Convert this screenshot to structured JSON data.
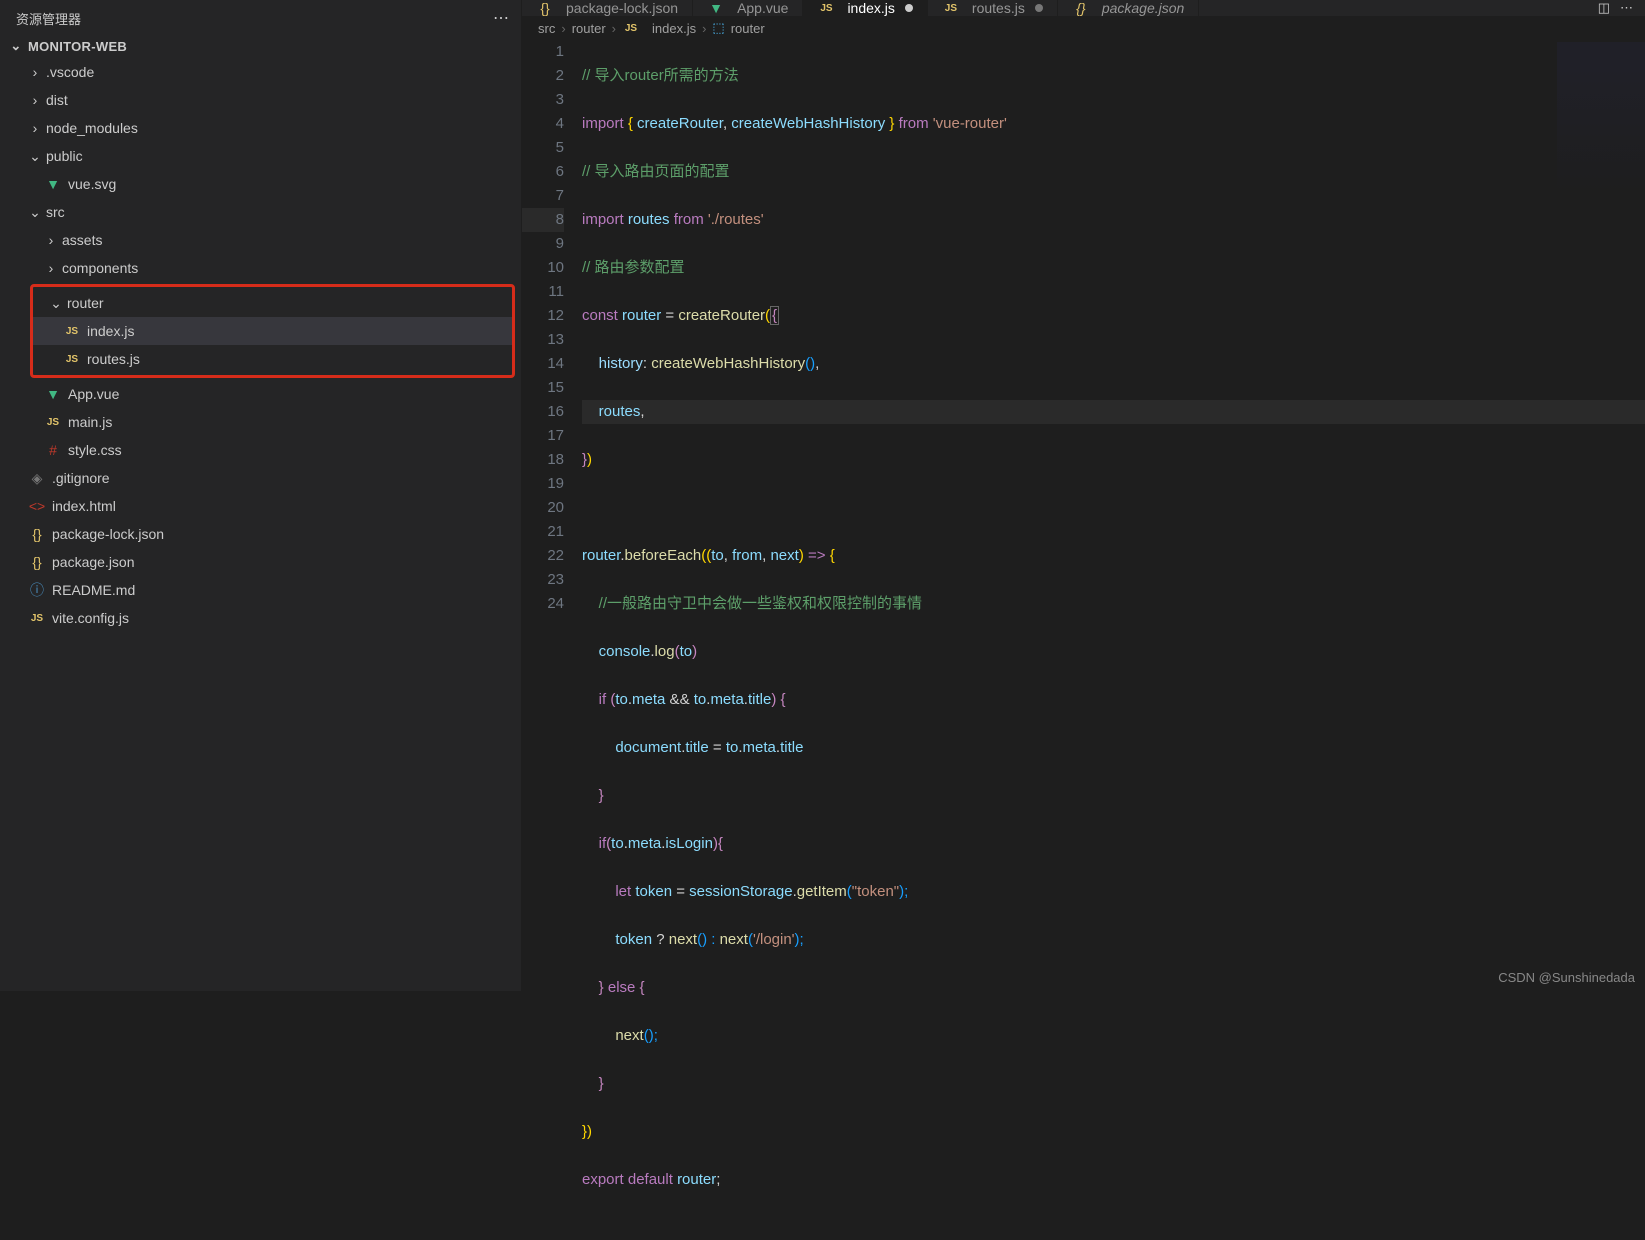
{
  "explorer": {
    "title": "资源管理器"
  },
  "project": {
    "name": "MONITOR-WEB"
  },
  "tree": {
    "vscode": ".vscode",
    "dist": "dist",
    "node_modules": "node_modules",
    "public": "public",
    "vuesvg": "vue.svg",
    "src": "src",
    "assets": "assets",
    "components": "components",
    "router": "router",
    "indexjs": "index.js",
    "routesjs": "routes.js",
    "appvue": "App.vue",
    "mainjs": "main.js",
    "stylecss": "style.css",
    "gitignore": ".gitignore",
    "indexhtml": "index.html",
    "pkglock": "package-lock.json",
    "pkg": "package.json",
    "readme": "README.md",
    "vitecfg": "vite.config.js"
  },
  "tabs": {
    "pkglock": "package-lock.json",
    "appvue": "App.vue",
    "indexjs": "index.js",
    "routesjs": "routes.js",
    "pkg": "package.json"
  },
  "breadcrumb": {
    "p1": "src",
    "p2": "router",
    "p3": "index.js",
    "p4": "router"
  },
  "lines": {
    "n1": "1",
    "n2": "2",
    "n3": "3",
    "n4": "4",
    "n5": "5",
    "n6": "6",
    "n7": "7",
    "n8": "8",
    "n9": "9",
    "n10": "10",
    "n11": "11",
    "n12": "12",
    "n13": "13",
    "n14": "14",
    "n15": "15",
    "n16": "16",
    "n17": "17",
    "n18": "18",
    "n19": "19",
    "n20": "20",
    "n21": "21",
    "n22": "22",
    "n23": "23",
    "n24": "24"
  },
  "code": {
    "c1": "// 导入router所需的方法",
    "c2a": "import",
    "c2b": "{ ",
    "c2c": "createRouter",
    "c2d": ", ",
    "c2e": "createWebHashHistory",
    "c2f": " }",
    "c2g": " from ",
    "c2h": "'vue-router'",
    "c3": "// 导入路由页面的配置",
    "c4a": "import ",
    "c4b": "routes",
    "c4c": " from ",
    "c4d": "'./routes'",
    "c5": "// 路由参数配置",
    "c6a": "const ",
    "c6b": "router",
    "c6c": " = ",
    "c6d": "createRouter",
    "c6e": "(",
    "c6f": "{",
    "c7a": "    history",
    "c7b": ": ",
    "c7c": "createWebHashHistory",
    "c7d": "()",
    "c7e": ",",
    "c8a": "    routes",
    "c8b": ",",
    "c9a": "}",
    "c9b": ")",
    "c11a": "router",
    "c11b": ".",
    "c11c": "beforeEach",
    "c11d": "((",
    "c11e": "to",
    "c11f": ", ",
    "c11g": "from",
    "c11h": ", ",
    "c11i": "next",
    "c11j": ") ",
    "c11k": "=>",
    "c11l": " {",
    "c12": "    //一般路由守卫中会做一些鉴权和权限控制的事情",
    "c13a": "    console",
    "c13b": ".",
    "c13c": "log",
    "c13d": "(",
    "c13e": "to",
    "c13f": ")",
    "c14a": "    if ",
    "c14b": "(",
    "c14c": "to",
    "c14d": ".",
    "c14e": "meta",
    "c14f": " && ",
    "c14g": "to",
    "c14h": ".",
    "c14i": "meta",
    "c14j": ".",
    "c14k": "title",
    "c14l": ") {",
    "c15a": "        document",
    "c15b": ".",
    "c15c": "title",
    "c15d": " = ",
    "c15e": "to",
    "c15f": ".",
    "c15g": "meta",
    "c15h": ".",
    "c15i": "title",
    "c16": "    }",
    "c17a": "    if",
    "c17b": "(",
    "c17c": "to",
    "c17d": ".",
    "c17e": "meta",
    "c17f": ".",
    "c17g": "isLogin",
    "c17h": "){",
    "c18a": "        let ",
    "c18b": "token",
    "c18c": " = ",
    "c18d": "sessionStorage",
    "c18e": ".",
    "c18f": "getItem",
    "c18g": "(",
    "c18h": "\"token\"",
    "c18i": ");",
    "c19a": "        token",
    "c19b": " ? ",
    "c19c": "next",
    "c19d": "() : ",
    "c19e": "next",
    "c19f": "(",
    "c19g": "'/login'",
    "c19h": ");",
    "c20a": "    } ",
    "c20b": "else",
    "c20c": " {",
    "c21a": "        next",
    "c21b": "();",
    "c22": "    }",
    "c23": "})",
    "c24a": "export default ",
    "c24b": "router",
    "c24c": ";"
  },
  "watermark": "CSDN @Sunshinedada"
}
